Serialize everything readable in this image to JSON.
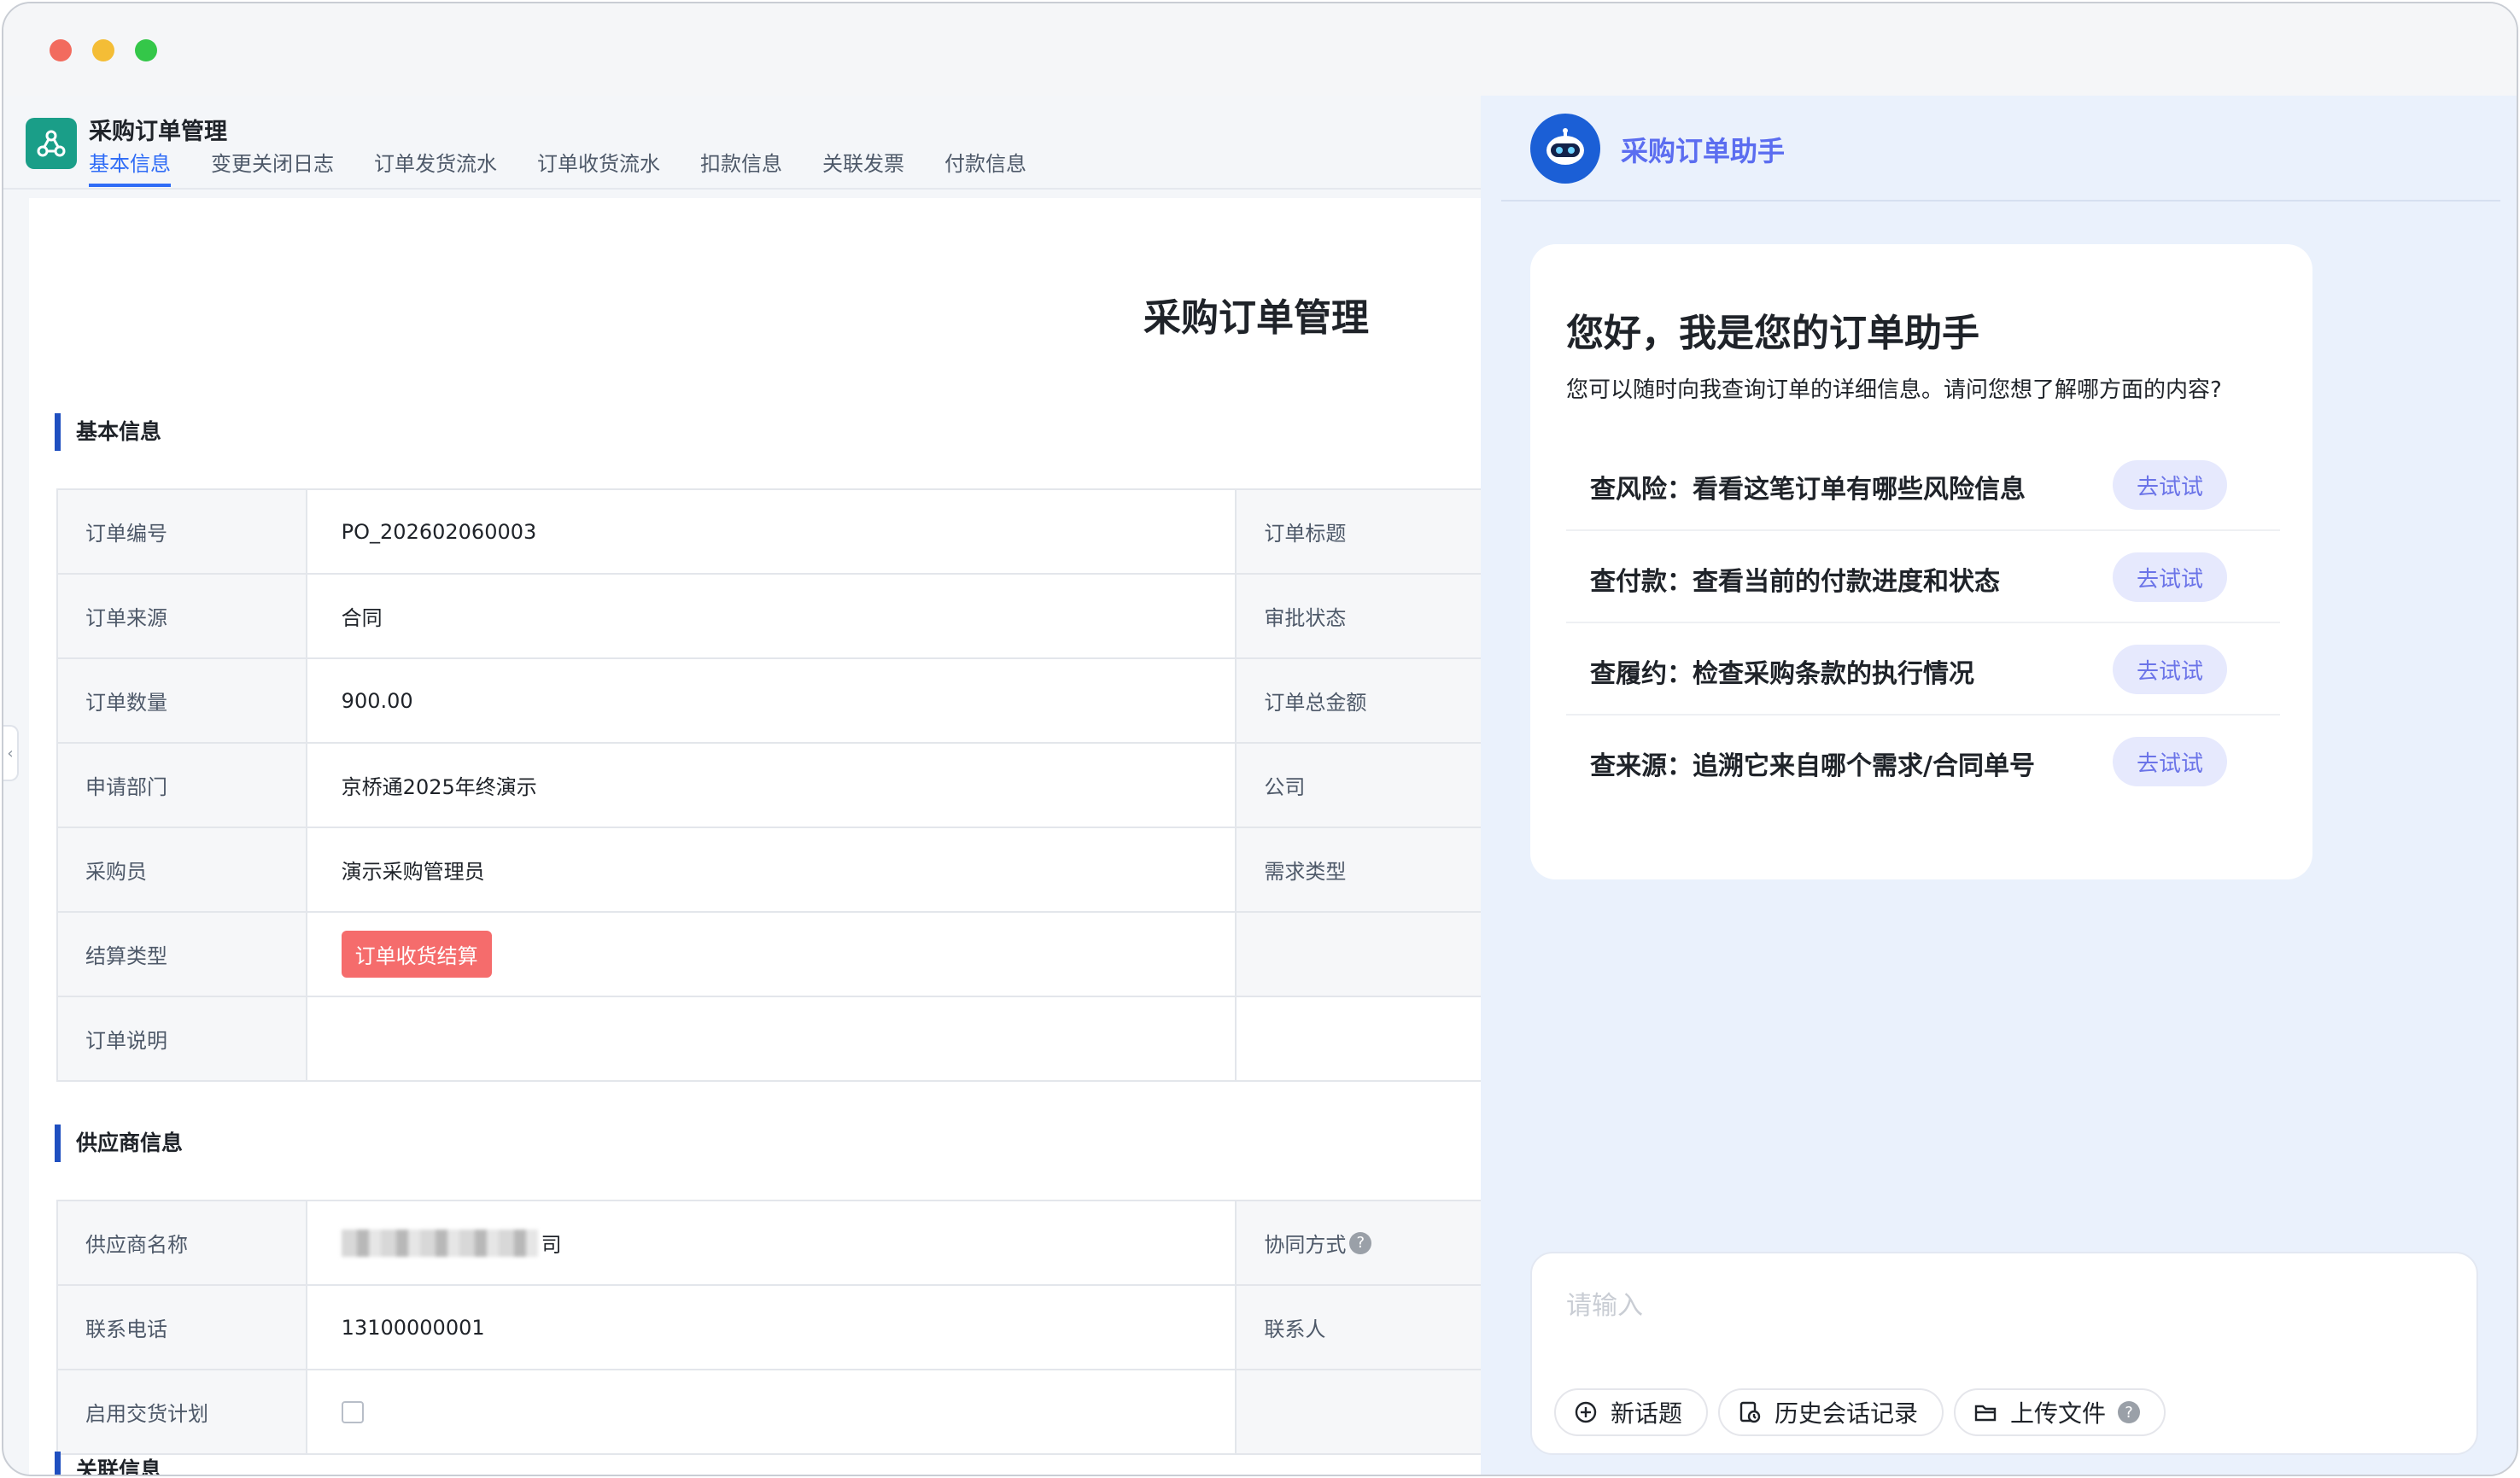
{
  "app": {
    "title": "采购订单管理",
    "tabs": [
      "基本信息",
      "变更关闭日志",
      "订单发货流水",
      "订单收货流水",
      "扣款信息",
      "关联发票",
      "付款信息"
    ],
    "active_tab": "基本信息"
  },
  "doc": {
    "title": "采购订单管理",
    "basic_section": "基本信息",
    "basic_rows": [
      {
        "label": "订单编号",
        "value": "PO_202602060003",
        "label2": "订单标题"
      },
      {
        "label": "订单来源",
        "value": "合同",
        "label2": "审批状态"
      },
      {
        "label": "订单数量",
        "value": "900.00",
        "label2": "订单总金额"
      },
      {
        "label": "申请部门",
        "value": "京桥通2025年终演示",
        "label2": "公司"
      },
      {
        "label": "采购员",
        "value": "演示采购管理员",
        "label2": "需求类型"
      },
      {
        "label": "结算类型",
        "value": "订单收货结算",
        "label2": ""
      },
      {
        "label": "订单说明",
        "value": "",
        "label2": ""
      }
    ],
    "supplier_section": "供应商信息",
    "supplier_rows": [
      {
        "label": "供应商名称",
        "value": "司",
        "label2": "协同方式"
      },
      {
        "label": "联系电话",
        "value": "13100000001",
        "label2": "联系人"
      },
      {
        "label": "启用交货计划",
        "value": "",
        "label2": ""
      }
    ],
    "next_section": "关联信息",
    "colors": {
      "tag": "#f56c6c",
      "accent": "#2f6cf6",
      "section_bar": "#1f4fc0"
    }
  },
  "assistant": {
    "title": "采购订单助手",
    "greeting": "您好，我是您的订单助手",
    "subtext": "您可以随时向我查询订单的详细信息。请问您想了解哪方面的内容?",
    "questions": [
      {
        "text": "查风险：看看这笔订单有哪些风险信息",
        "button": "去试试"
      },
      {
        "text": "查付款：查看当前的付款进度和状态",
        "button": "去试试"
      },
      {
        "text": "查履约：检查采购条款的执行情况",
        "button": "去试试"
      },
      {
        "text": "查来源：追溯它来自哪个需求/合同单号",
        "button": "去试试"
      }
    ],
    "input_placeholder": "请输入",
    "tools": [
      "新话题",
      "历史会话记录",
      "上传文件"
    ],
    "help_glyph": "?"
  }
}
